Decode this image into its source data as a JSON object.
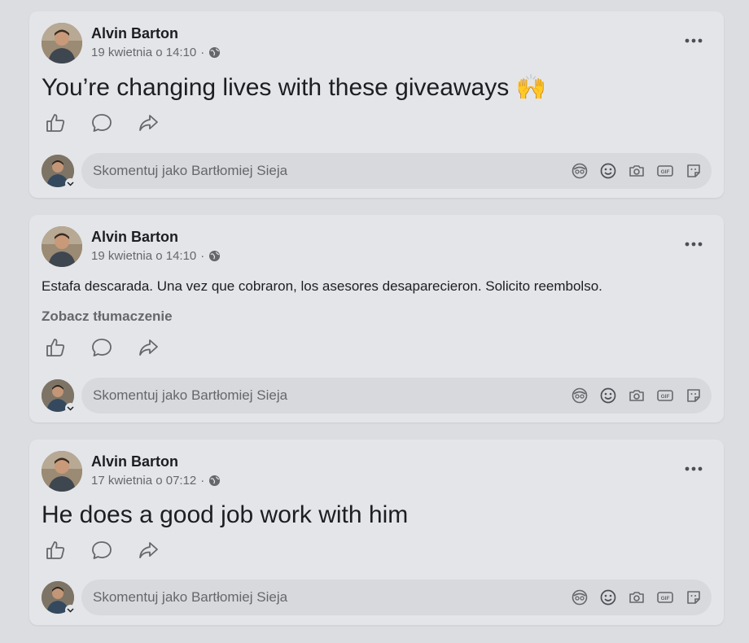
{
  "posts": [
    {
      "author": "Alvin Barton",
      "date": "19 kwietnia o 14:10",
      "separator": "·",
      "text": "You’re changing lives with these giveaways 🙌",
      "text_size": "big",
      "translate_label": "",
      "comment_placeholder": "Skomentuj jako Bartłomiej Sieja"
    },
    {
      "author": "Alvin Barton",
      "date": "19 kwietnia o 14:10",
      "separator": "·",
      "text": "Estafa descarada. Una vez que cobraron, los asesores desaparecieron. Solicito reembolso.",
      "text_size": "small",
      "translate_label": "Zobacz tłumaczenie",
      "comment_placeholder": "Skomentuj jako Bartłomiej Sieja"
    },
    {
      "author": "Alvin Barton",
      "date": "17 kwietnia o 07:12",
      "separator": "·",
      "text": "He does a good job work with him",
      "text_size": "big",
      "translate_label": "",
      "comment_placeholder": "Skomentuj jako Bartłomiej Sieja"
    }
  ],
  "icons": {
    "audience": "globe-icon",
    "more": "more-options-icon",
    "actions": [
      "like-icon",
      "comment-icon",
      "share-icon"
    ],
    "comment_tools": [
      "avatar-sticker-icon",
      "emoji-icon",
      "camera-icon",
      "gif-icon",
      "sticker-icon"
    ]
  },
  "colors": {
    "page_bg": "#dcdde1",
    "card_bg": "#e4e5e8",
    "input_bg": "#d8d9dc",
    "secondary_text": "#65676b"
  }
}
